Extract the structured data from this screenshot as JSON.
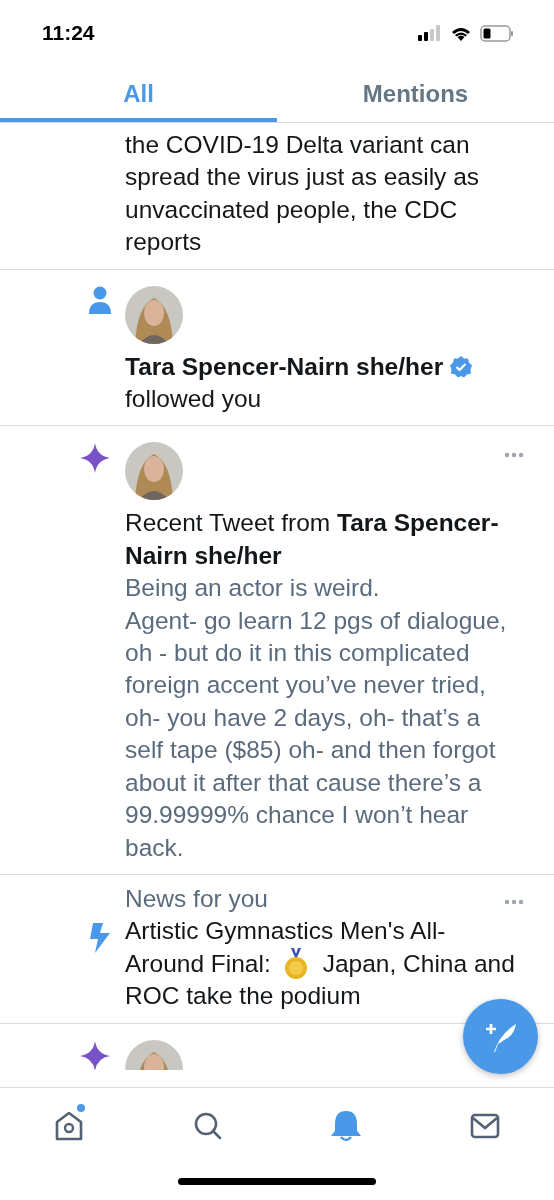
{
  "status_bar": {
    "time": "11:24"
  },
  "tabs": [
    {
      "label": "All",
      "selected": true
    },
    {
      "label": "Mentions",
      "selected": false
    }
  ],
  "feed": [
    {
      "kind": "news_cut",
      "text": "the COVID-19 Delta variant can spread the virus just as easily as unvaccinated people, the CDC reports"
    },
    {
      "kind": "follow",
      "user": "Tara Spencer-Nairn she/her",
      "verified": true,
      "action": "followed you"
    },
    {
      "kind": "recent_tweet",
      "title": "Recent Tweet from **Tara Spencer-Nairn she/her**",
      "body": "Being an actor is weird.\nAgent- go learn 12 pgs of dialogue, oh - but do it in this complicated foreign accent you’ve never tried, oh- you have 2 days, oh- that’s a self tape ($85) oh- and then forgot about it after that cause there’s a 99.99999% chance I won’t hear back."
    },
    {
      "kind": "news",
      "label": "News for you",
      "lines": [
        [
          "Artistic Gymnastics Men's All-"
        ],
        [
          "Around Final:",
          "Japan, China and"
        ],
        [
          "ROC take the podium"
        ]
      ]
    },
    {
      "kind": "recent_cut"
    }
  ],
  "nav": [
    {
      "kind": "home",
      "selected": false,
      "badge": true
    },
    {
      "kind": "search",
      "selected": false,
      "badge": false
    },
    {
      "kind": "bell",
      "selected": true,
      "badge": false
    },
    {
      "kind": "mail",
      "selected": false,
      "badge": false
    }
  ]
}
